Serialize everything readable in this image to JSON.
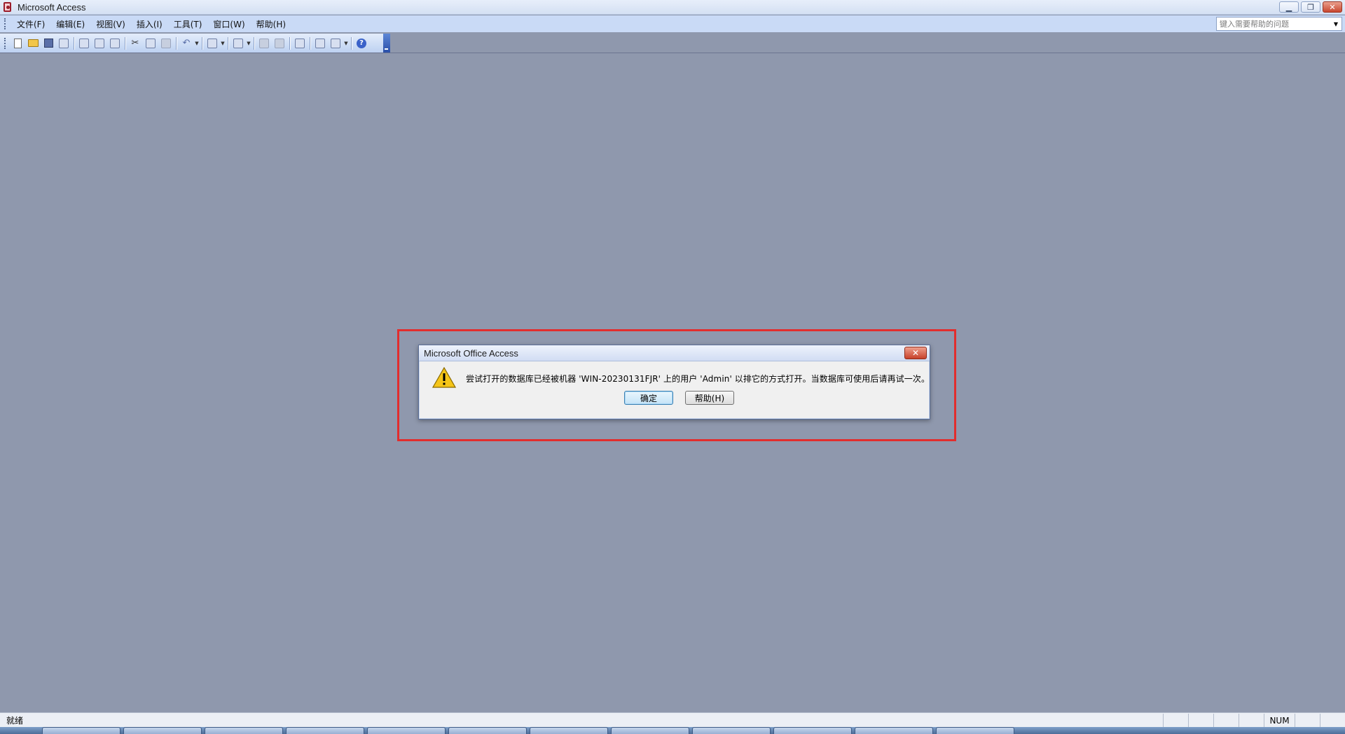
{
  "window": {
    "title": "Microsoft Access",
    "controls": [
      "minimize-icon",
      "restore-icon",
      "close-icon"
    ]
  },
  "menubar": {
    "items": [
      {
        "label": "文件(F)"
      },
      {
        "label": "编辑(E)"
      },
      {
        "label": "视图(V)"
      },
      {
        "label": "插入(I)"
      },
      {
        "label": "工具(T)"
      },
      {
        "label": "窗口(W)"
      },
      {
        "label": "帮助(H)"
      }
    ],
    "help_search": {
      "placeholder": "键入需要帮助的问题"
    }
  },
  "toolbar": {
    "icons": [
      "new-icon",
      "open-icon",
      "save-icon",
      "file-search-icon",
      "print-icon",
      "print-preview-icon",
      "spelling-icon",
      "cut-icon",
      "copy-icon",
      "paste-icon",
      "undo-icon",
      "office-links-icon",
      "analyze-icon",
      "code-icon",
      "script-icon",
      "properties-icon",
      "relationships-icon",
      "new-object-icon",
      "help-icon"
    ]
  },
  "dialog": {
    "title": "Microsoft Office Access",
    "message": "尝试打开的数据库已经被机器 'WIN-20230131FJR' 上的用户 'Admin' 以排它的方式打开。当数据库可使用后请再试一次。",
    "ok_label": "确定",
    "help_label": "帮助(H)"
  },
  "statusbar": {
    "text": "就绪",
    "num_indicator": "NUM"
  },
  "colors": {
    "workspace": "#8f98ad",
    "highlight": "#e22d2d"
  }
}
